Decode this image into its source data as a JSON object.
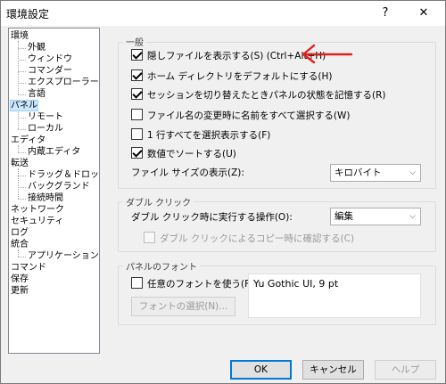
{
  "window": {
    "title": "環境設定",
    "help_glyph": "?",
    "close_glyph": "✕"
  },
  "tree": {
    "items": [
      {
        "label": "環境",
        "level": 0
      },
      {
        "label": "外観",
        "level": 1
      },
      {
        "label": "ウィンドウ",
        "level": 1
      },
      {
        "label": "コマンダー",
        "level": 1
      },
      {
        "label": "エクスプローラー",
        "level": 1
      },
      {
        "label": "言語",
        "level": 1
      },
      {
        "label": "パネル",
        "level": 0,
        "selected": true
      },
      {
        "label": "リモート",
        "level": 1
      },
      {
        "label": "ローカル",
        "level": 1
      },
      {
        "label": "エディタ",
        "level": 0
      },
      {
        "label": "内蔵エディタ",
        "level": 1
      },
      {
        "label": "転送",
        "level": 0
      },
      {
        "label": "ドラッグ＆ドロップ",
        "level": 1
      },
      {
        "label": "バックグランド",
        "level": 1
      },
      {
        "label": "接続時間",
        "level": 1
      },
      {
        "label": "ネットワーク",
        "level": 0
      },
      {
        "label": "セキュリティ",
        "level": 0
      },
      {
        "label": "ログ",
        "level": 0
      },
      {
        "label": "統合",
        "level": 0
      },
      {
        "label": "アプリケーション",
        "level": 1
      },
      {
        "label": "コマンド",
        "level": 0
      },
      {
        "label": "保存",
        "level": 0
      },
      {
        "label": "更新",
        "level": 0
      }
    ]
  },
  "general": {
    "title": "一般",
    "options": [
      {
        "label": "隠しファイルを表示する(S) (Ctrl+Alt+H)",
        "checked": true
      },
      {
        "label": "ホーム ディレクトリをデフォルトにする(H)",
        "checked": true
      },
      {
        "label": "セッションを切り替えたときパネルの状態を記憶する(R)",
        "checked": true
      },
      {
        "label": "ファイル名の変更時に名前をすべて選択する(W)",
        "checked": false
      },
      {
        "label": "1 行すべてを選択表示する(F)",
        "checked": false
      },
      {
        "label": "数値でソートする(U)",
        "checked": true
      }
    ],
    "filesize_label": "ファイル サイズの表示(Z):",
    "filesize_value": "キロバイト"
  },
  "doubleclick": {
    "title": "ダブル クリック",
    "action_label": "ダブル クリック時に実行する操作(O):",
    "action_value": "編集",
    "confirm_label": "ダブル クリックによるコピー時に確認する(C)",
    "confirm_checked": false
  },
  "panelfont": {
    "title": "パネルのフォント",
    "custom_label": "任意のフォントを使う(F)",
    "custom_checked": false,
    "select_button": "フォントの選択(N)...",
    "preview": "Yu Gothic UI, 9 pt"
  },
  "footer": {
    "ok": "OK",
    "cancel": "キャンセル",
    "help": "ヘルプ"
  },
  "colors": {
    "annotation_arrow": "#e0201c",
    "selection": "#cce8ff",
    "default_button_border": "#0078d7"
  }
}
